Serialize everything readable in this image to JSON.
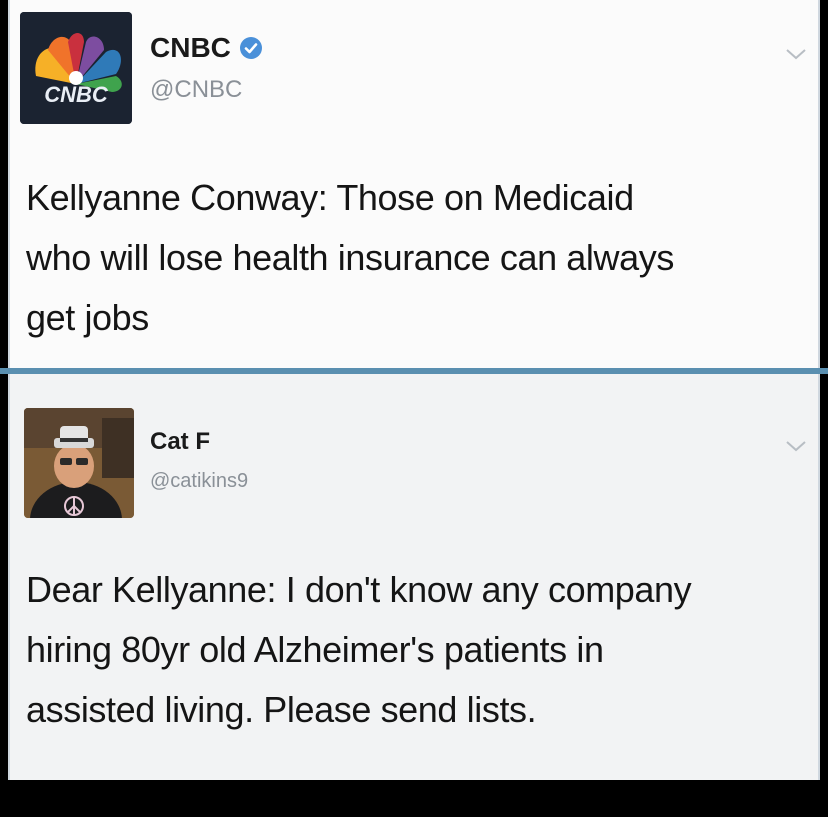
{
  "tweets": [
    {
      "display_name": "CNBC",
      "handle": "@CNBC",
      "verified": true,
      "avatar": "cnbc-peacock-logo",
      "avatar_text": "CNBC",
      "text": "Kellyanne Conway: Those on Medicaid\nwho will lose health insurance can always\nget jobs"
    },
    {
      "display_name": "Cat F",
      "handle": "@catikins9",
      "verified": false,
      "avatar": "user-photo",
      "text": "Dear Kellyanne: I don't know any company\nhiring 80yr old Alzheimer's patients in\nassisted living. Please send lists."
    }
  ],
  "icons": {
    "verified": "verified-badge-icon",
    "menu": "chevron-down-icon"
  },
  "colors": {
    "separator": "#5a8fb0",
    "verified_badge": "#4a90d9",
    "handle": "#8a9097"
  }
}
